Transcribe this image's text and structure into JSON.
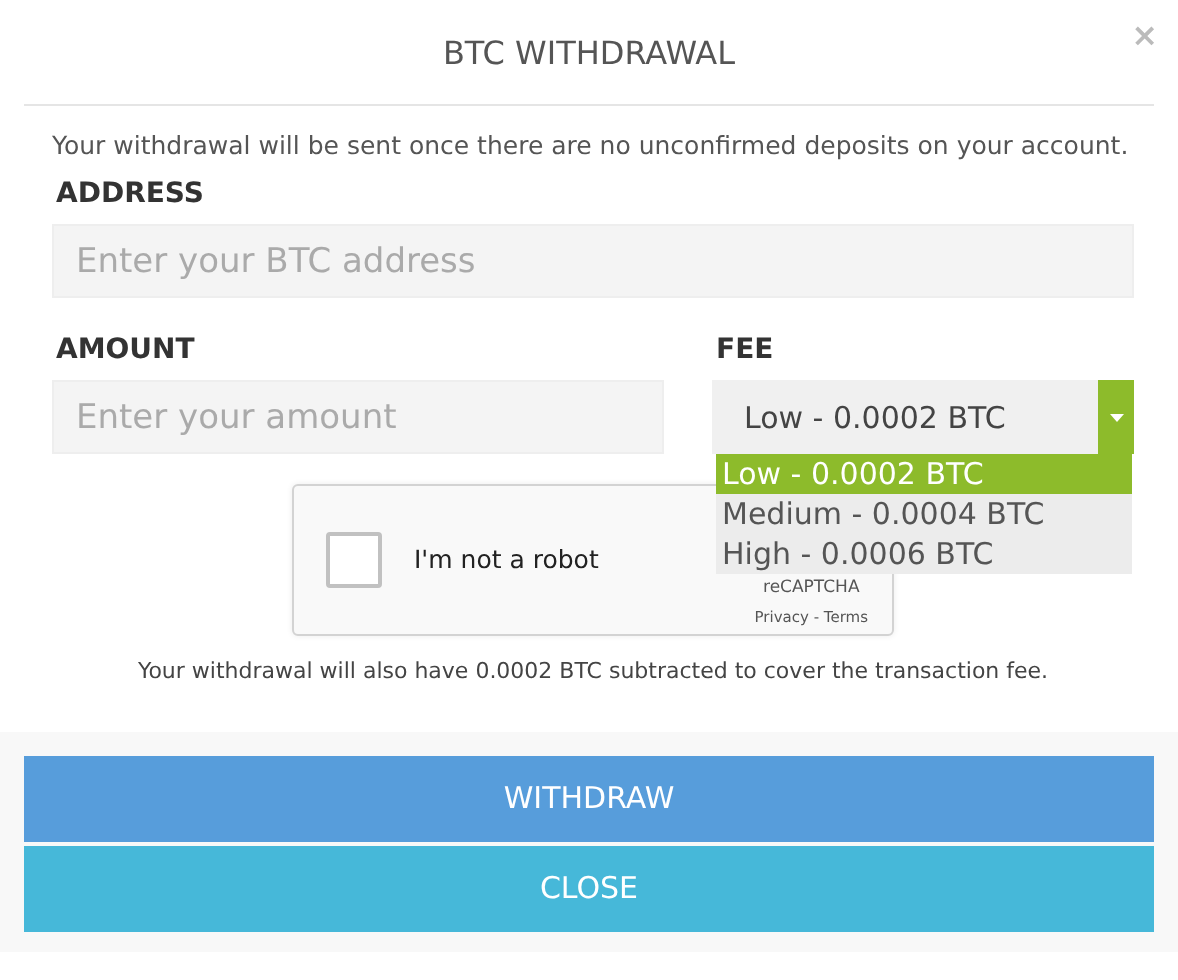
{
  "dialog": {
    "title": "BTC WITHDRAWAL",
    "close_glyph": "×"
  },
  "notice": "Your withdrawal will be sent once there are no unconfirmed deposits on your account.",
  "address": {
    "label": "ADDRESS",
    "placeholder": "Enter your BTC address"
  },
  "amount": {
    "label": "AMOUNT",
    "placeholder": "Enter your amount"
  },
  "fee": {
    "label": "FEE",
    "value": "Low - 0.0002 BTC",
    "expanded": true,
    "options": [
      {
        "label": "Low - 0.0002 BTC",
        "selected": true
      },
      {
        "label": "Medium - 0.0004 BTC",
        "selected": false
      },
      {
        "label": "High - 0.0006 BTC",
        "selected": false
      }
    ]
  },
  "captcha": {
    "label": "I'm not a robot",
    "checked": false,
    "brand": "reCAPTCHA",
    "links": "Privacy - Terms"
  },
  "fee_note": "Your withdrawal will also have 0.0002 BTC subtracted to cover the transaction fee.",
  "buttons": [
    {
      "label": "WITHDRAW",
      "kind": "primary"
    },
    {
      "label": "CLOSE",
      "kind": "secondary"
    }
  ]
}
